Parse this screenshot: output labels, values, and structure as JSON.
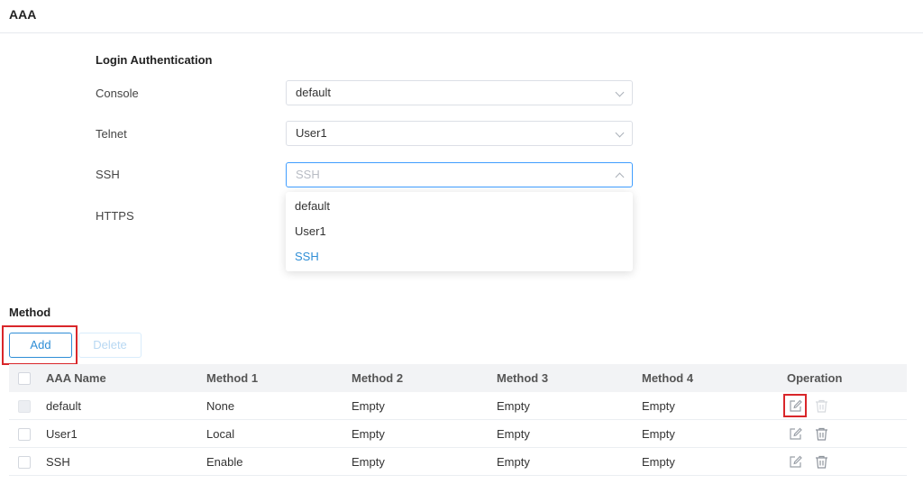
{
  "page_title": "AAA",
  "login_auth": {
    "title": "Login Authentication",
    "fields": [
      {
        "label": "Console",
        "value": "default"
      },
      {
        "label": "Telnet",
        "value": "User1"
      },
      {
        "label": "SSH",
        "placeholder": "SSH"
      },
      {
        "label": "HTTPS"
      }
    ],
    "dropdown_options": [
      "default",
      "User1",
      "SSH"
    ],
    "dropdown_selected": "SSH"
  },
  "method": {
    "title": "Method",
    "add_label": "Add",
    "delete_label": "Delete",
    "columns": [
      "AAA Name",
      "Method 1",
      "Method 2",
      "Method 3",
      "Method 4",
      "Operation"
    ],
    "rows": [
      {
        "name": "default",
        "m1": "None",
        "m2": "Empty",
        "m3": "Empty",
        "m4": "Empty"
      },
      {
        "name": "User1",
        "m1": "Local",
        "m2": "Empty",
        "m3": "Empty",
        "m4": "Empty"
      },
      {
        "name": "SSH",
        "m1": "Enable",
        "m2": "Empty",
        "m3": "Empty",
        "m4": "Empty"
      }
    ]
  },
  "colors": {
    "accent": "#2f8ed6",
    "highlight": "#d9262a",
    "header_bg": "#f2f3f5"
  },
  "icons": {
    "edit": "edit-icon",
    "delete": "trash-icon",
    "chevron": "chevron-down-icon"
  }
}
